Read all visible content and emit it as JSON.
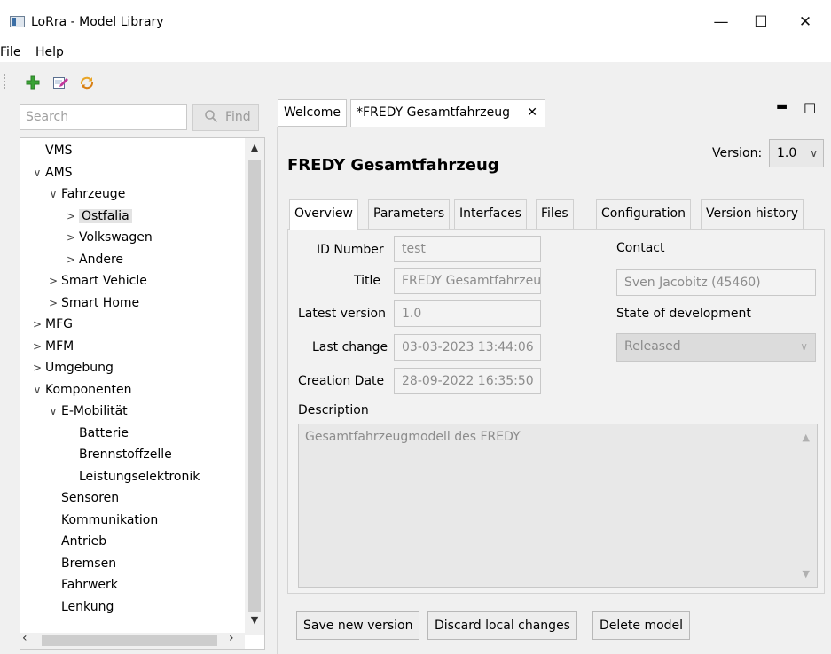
{
  "window": {
    "title": "LoRra - Model Library",
    "minimize": "—",
    "maximize": "☐",
    "close": "✕"
  },
  "menu": [
    "File",
    "Help"
  ],
  "toolbar": {
    "icons": [
      "add-icon",
      "edit-icon",
      "sync-icon"
    ]
  },
  "search": {
    "placeholder": "Search",
    "value": "",
    "find_label": "Find"
  },
  "tree": [
    {
      "label": "VMS",
      "level": 0,
      "expander": ""
    },
    {
      "label": "AMS",
      "level": 0,
      "expander": "∨"
    },
    {
      "label": "Fahrzeuge",
      "level": 1,
      "expander": "∨"
    },
    {
      "label": "Ostfalia",
      "level": 2,
      "expander": ">",
      "selected": true
    },
    {
      "label": "Volkswagen",
      "level": 2,
      "expander": ">"
    },
    {
      "label": "Andere",
      "level": 2,
      "expander": ">"
    },
    {
      "label": "Smart Vehicle",
      "level": 1,
      "expander": ">"
    },
    {
      "label": "Smart Home",
      "level": 1,
      "expander": ">"
    },
    {
      "label": "MFG",
      "level": 0,
      "expander": ">"
    },
    {
      "label": "MFM",
      "level": 0,
      "expander": ">"
    },
    {
      "label": "Umgebung",
      "level": 0,
      "expander": ">"
    },
    {
      "label": "Komponenten",
      "level": 0,
      "expander": "∨"
    },
    {
      "label": "E-Mobilität",
      "level": 1,
      "expander": "∨"
    },
    {
      "label": "Batterie",
      "level": 2,
      "expander": ""
    },
    {
      "label": "Brennstoffzelle",
      "level": 2,
      "expander": ""
    },
    {
      "label": "Leistungselektronik",
      "level": 2,
      "expander": ""
    },
    {
      "label": "Sensoren",
      "level": 1,
      "expander": ""
    },
    {
      "label": "Kommunikation",
      "level": 1,
      "expander": ""
    },
    {
      "label": "Antrieb",
      "level": 1,
      "expander": ""
    },
    {
      "label": "Bremsen",
      "level": 1,
      "expander": ""
    },
    {
      "label": "Fahrwerk",
      "level": 1,
      "expander": ""
    },
    {
      "label": "Lenkung",
      "level": 1,
      "expander": ""
    }
  ],
  "editor": {
    "tabs": [
      {
        "label": "Welcome",
        "closable": false
      },
      {
        "label": "*FREDY Gesamtfahrzeug",
        "closable": true,
        "active": true
      }
    ],
    "tab_close": "✕",
    "panel_minimize": "▭",
    "panel_maximize": "□",
    "model_title": "FREDY Gesamtfahrzeug",
    "version_label": "Version:",
    "version_value": "1.0",
    "inner_tabs": [
      "Overview",
      "Parameters",
      "Interfaces",
      "Files",
      "Configuration",
      "Version history"
    ],
    "fields": {
      "id_number": {
        "label": "ID Number",
        "value": "test"
      },
      "title": {
        "label": "Title",
        "value": "FREDY Gesamtfahrzeug"
      },
      "latest_version": {
        "label": "Latest version",
        "value": "1.0"
      },
      "last_change": {
        "label": "Last change",
        "value": "03-03-2023 13:44:06"
      },
      "creation_date": {
        "label": "Creation Date",
        "value": "28-09-2022 16:35:50"
      },
      "contact": {
        "label": "Contact",
        "value": "Sven Jacobitz (45460)"
      },
      "state": {
        "label": "State of development",
        "value": "Released"
      },
      "description": {
        "label": "Description",
        "value": "Gesamtfahrzeugmodell des FREDY"
      }
    },
    "buttons": {
      "save": "Save new version",
      "discard": "Discard local changes",
      "delete": "Delete model"
    }
  }
}
